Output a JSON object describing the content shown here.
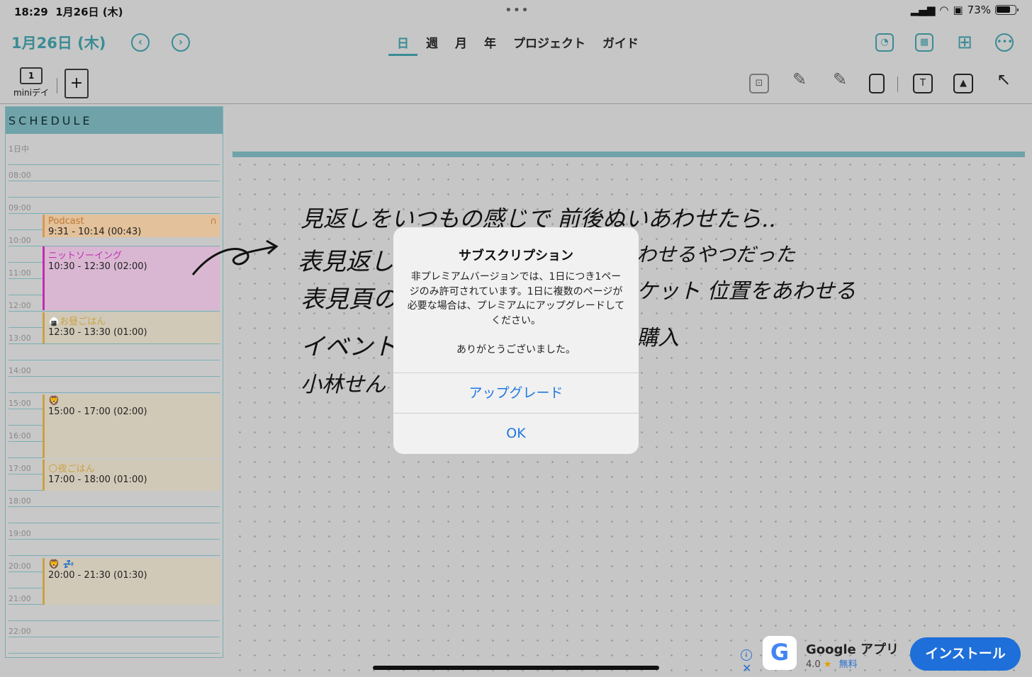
{
  "status_bar": {
    "time": "18:29",
    "date": "1月26日 (木)",
    "battery": "73%"
  },
  "header": {
    "date_title": "1月26日 (木)",
    "tabs": [
      "日",
      "週",
      "月",
      "年",
      "プロジェクト",
      "ガイド"
    ],
    "active_tab": "日",
    "accent_color": "#3a8c94"
  },
  "toolbar": {
    "mini_day_number": "1",
    "mini_day_label": "miniデイ",
    "add_page_label": "+"
  },
  "schedule": {
    "title": "SCHEDULE",
    "all_day_label": "1日中",
    "hours": [
      "08:00",
      "09:00",
      "10:00",
      "11:00",
      "12:00",
      "13:00",
      "14:00",
      "15:00",
      "16:00",
      "17:00",
      "18:00",
      "19:00",
      "20:00",
      "21:00",
      "22:00"
    ],
    "events": [
      {
        "title": "Podcast",
        "time": "9:31 - 10:14 (00:43)",
        "color": "#f0c9a0",
        "border": "#d49a55",
        "title_color": "#c07b35",
        "icon": ""
      },
      {
        "title": "ニットソーイング",
        "time": "10:30 - 12:30 (02:00)",
        "color": "#e6c4e0",
        "border": "#c42bb4",
        "title_color": "#c42bb4",
        "icon": ""
      },
      {
        "title": "お昼ごはん",
        "time": "12:30 - 13:30 (01:00)",
        "color": "#d4cdbd",
        "border": "#c9a243",
        "title_color": "#c9a243",
        "icon": "🍙"
      },
      {
        "title": "",
        "time": "15:00 - 17:00 (02:00)",
        "color": "#d4cdbd",
        "border": "#c9a243",
        "title_color": "#c9a243",
        "icon": "🦁"
      },
      {
        "title": "夜ごはん",
        "time": "17:00 - 18:00 (01:00)",
        "color": "#d4cdbd",
        "border": "#c9a243",
        "title_color": "#c9a243",
        "icon": "🌕"
      },
      {
        "title": "",
        "time": "20:00 - 21:30 (01:30)",
        "color": "#d4cdbd",
        "border": "#c9a243",
        "title_color": "#c9a243",
        "icon": "🦁 💤"
      }
    ]
  },
  "handwriting": [
    "見返しをいつもの感じで 前後ぬいあわせたら..",
    "表見返しと",
    "わせるやつだった",
    "表見頁の",
    "ケット 位置をあわせる",
    "イベント",
    "購入",
    "小林せん"
  ],
  "dialog": {
    "title": "サブスクリプション",
    "message": "非プレミアムバージョンでは、1日につき1ページのみ許可されています。1日に複数のページが必要な場合は、プレミアムにアップグレードしてください。",
    "thanks": "ありがとうございました。",
    "upgrade_label": "アップグレード",
    "ok_label": "OK",
    "button_color": "#1e78e0"
  },
  "ad": {
    "app_name": "Google アプリ",
    "rating": "4.0",
    "star": "★",
    "price": "無料",
    "install_label": "インストール",
    "logo_letter": "G",
    "info_icon": "i",
    "close_icon": "✕"
  },
  "icons": {
    "prev": "‹",
    "next": "›"
  }
}
